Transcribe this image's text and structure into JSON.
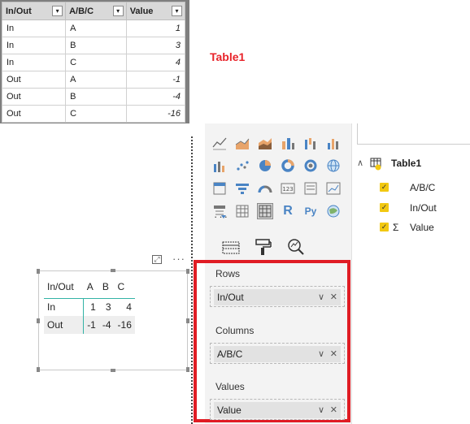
{
  "excel_table": {
    "headers": [
      "In/Out",
      "A/B/C",
      "Value"
    ],
    "rows": [
      [
        "In",
        "A",
        "1"
      ],
      [
        "In",
        "B",
        "3"
      ],
      [
        "In",
        "C",
        "4"
      ],
      [
        "Out",
        "A",
        "-1"
      ],
      [
        "Out",
        "B",
        "-4"
      ],
      [
        "Out",
        "C",
        "-16"
      ]
    ],
    "dropdown_glyph": "▾"
  },
  "table_label": "Table1",
  "matrix": {
    "header": [
      "In/Out",
      "A",
      "B",
      "C"
    ],
    "rows": [
      [
        "In",
        "1",
        "3",
        "4"
      ],
      [
        "Out",
        "-1",
        "-4",
        "-16"
      ]
    ],
    "more_glyph": "···",
    "focus_glyph": "⤢"
  },
  "viz_pane": {
    "more_glyph": "···",
    "icons": [
      "line-chart-icon",
      "area-chart-icon",
      "stacked-area-icon",
      "ribbon-chart-icon",
      "waterfall-icon",
      "funnel-area-icon",
      "bar-combo-icon",
      "scatter-icon",
      "pie-chart-icon",
      "donut-icon",
      "treemap-icon",
      "globe-map-icon",
      "filled-map-icon",
      "funnel-icon",
      "gauge-icon",
      "card-icon",
      "multi-row-card-icon",
      "kpi-icon",
      "slicer-icon",
      "table-icon",
      "matrix-icon",
      "r-visual-icon",
      "python-visual-icon",
      "arcgis-icon"
    ],
    "r_glyph": "R",
    "py_glyph": "Py",
    "wells": {
      "rows_label": "Rows",
      "rows_field": "In/Out",
      "columns_label": "Columns",
      "columns_field": "A/B/C",
      "values_label": "Values",
      "values_field": "Value",
      "chevron": "∨",
      "remove": "✕"
    }
  },
  "fields_pane": {
    "table_name": "Table1",
    "collapse_glyph": "∧",
    "sigma_glyph": "Σ",
    "check_glyph": "✓",
    "fields": [
      "A/B/C",
      "In/Out",
      "Value"
    ]
  },
  "colors": {
    "accent_red": "#e01c24",
    "table1_red": "#e8232a",
    "checkbox_yellow": "#f2c811",
    "matrix_teal": "#33b3a6"
  }
}
